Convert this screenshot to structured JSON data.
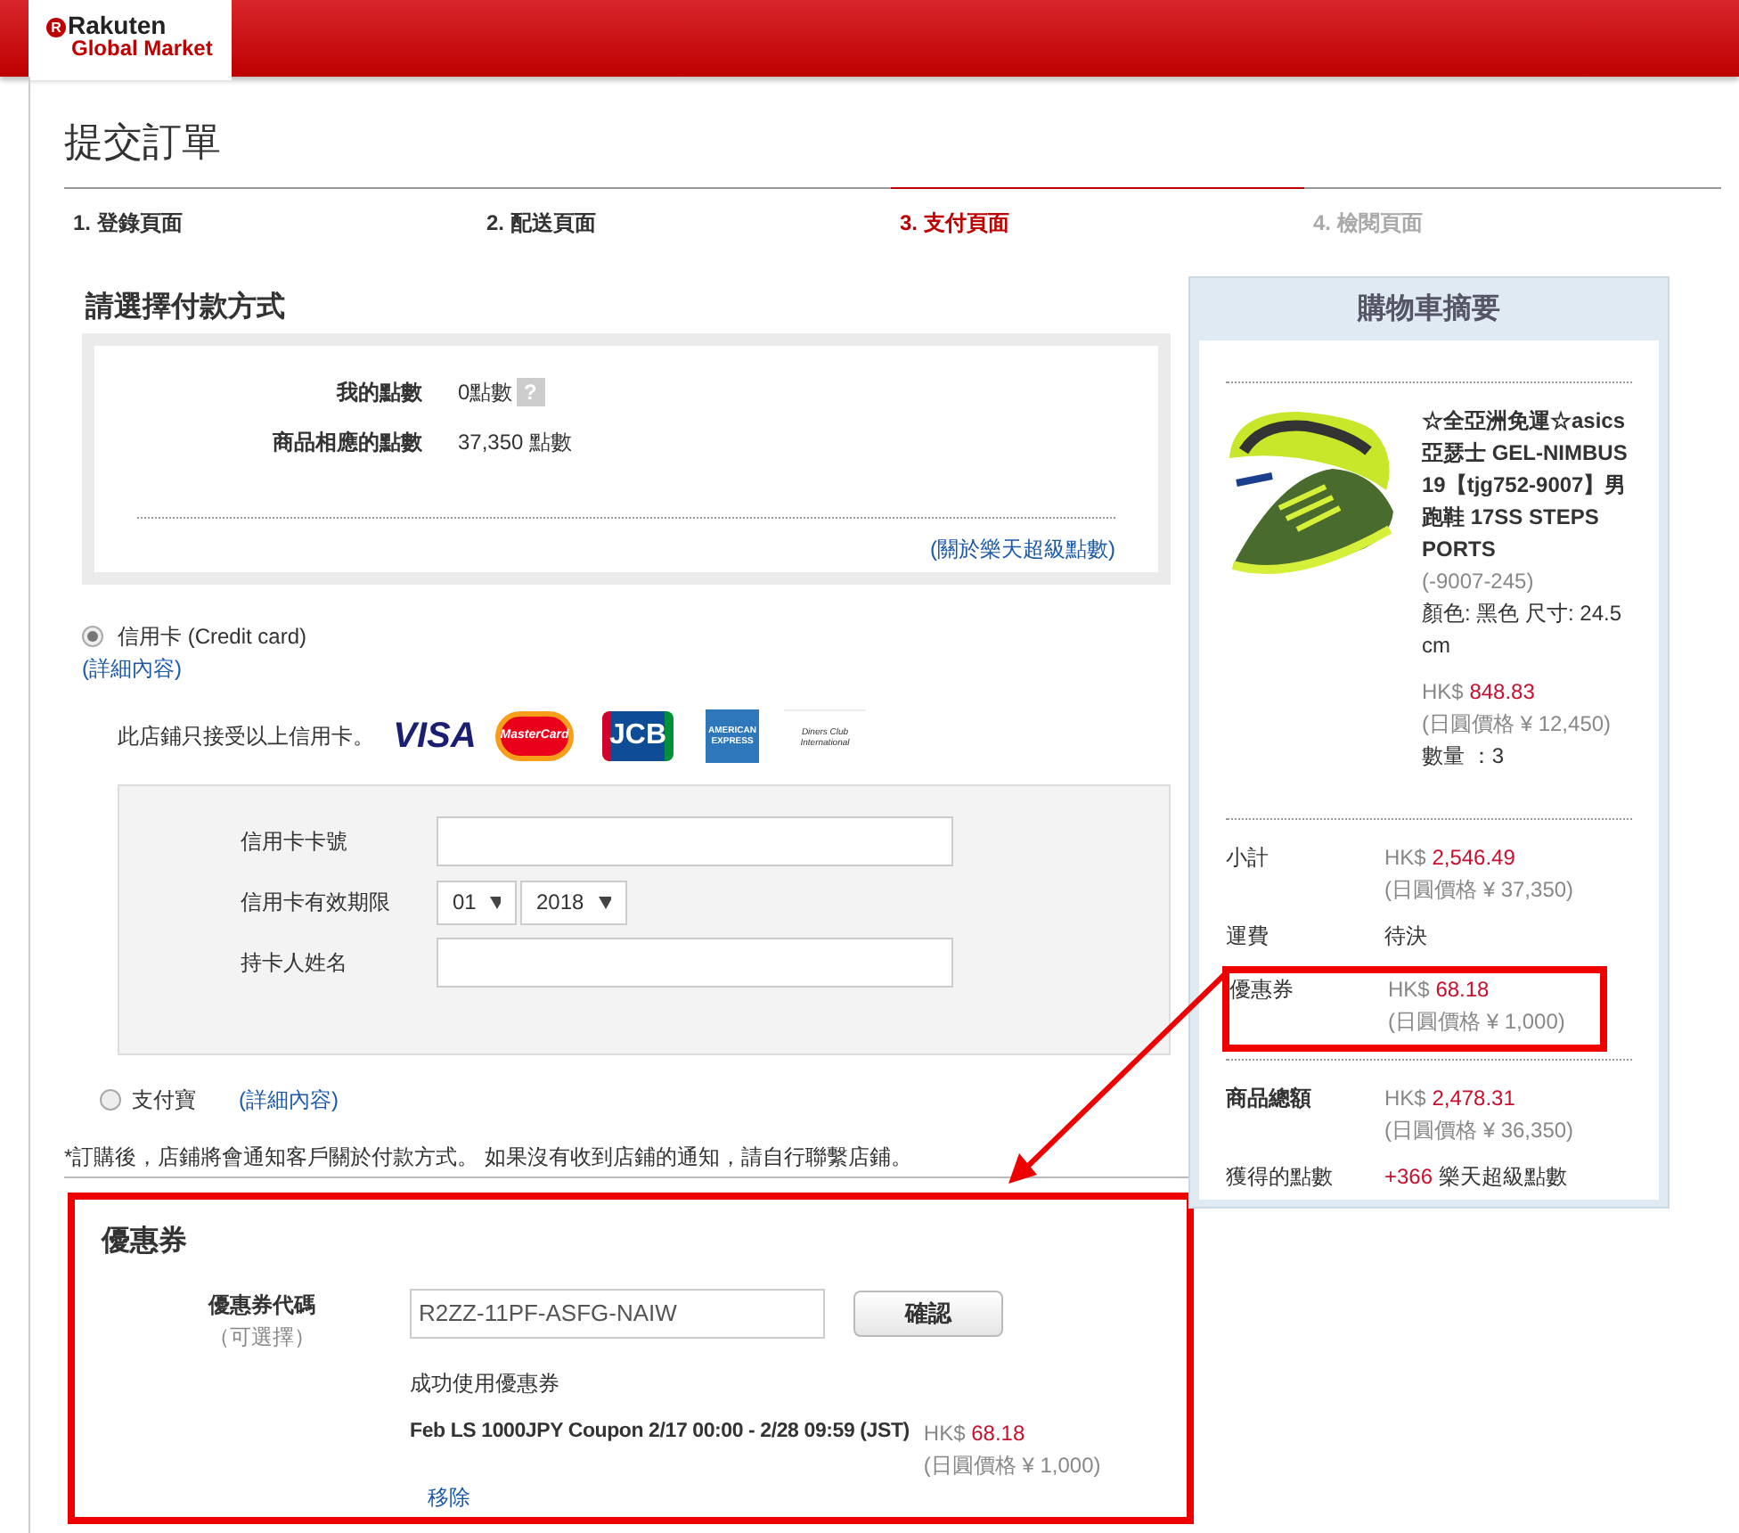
{
  "header": {
    "logo_mark": "R",
    "logo_line1": "Rakuten",
    "logo_line2": "Global Market"
  },
  "page_title": "提交訂單",
  "steps": [
    {
      "label": "1. 登錄頁面",
      "selected": false,
      "disabled": false
    },
    {
      "label": "2. 配送頁面",
      "selected": false,
      "disabled": false
    },
    {
      "label": "3. 支付頁面",
      "selected": true,
      "disabled": false
    },
    {
      "label": "4. 檢閱頁面",
      "selected": false,
      "disabled": true
    }
  ],
  "payment": {
    "heading": "請選擇付款方式",
    "points": [
      {
        "label": "我的點數",
        "value": "0點數",
        "help": "?"
      },
      {
        "label": "商品相應的點數",
        "value": "37,350 點數"
      }
    ],
    "points_link": "(關於樂天超級點數)",
    "credit_card": {
      "label": "信用卡 (Credit card)",
      "selected": true,
      "details_link": "(詳細內容)",
      "note": "此店鋪只接受以上信用卡。",
      "brands": [
        {
          "kind": "visa",
          "text": "VISA"
        },
        {
          "kind": "mastercard",
          "text": "MasterCard"
        },
        {
          "kind": "jcb",
          "text": "JCB"
        },
        {
          "kind": "amex",
          "text": "AMERICAN EXPRESS"
        },
        {
          "kind": "diners",
          "text": "Diners Club International"
        }
      ],
      "fields": [
        {
          "kind": "text",
          "label": "信用卡卡號"
        },
        {
          "kind": "select",
          "label": "信用卡有效期限",
          "options": [
            "01",
            "2018"
          ]
        },
        {
          "kind": "text",
          "label": "持卡人姓名"
        }
      ]
    },
    "alipay": {
      "label": "支付寶",
      "selected": false,
      "details_link": "(詳細內容)"
    },
    "notice": "*訂購後，店鋪將會通知客戶關於付款方式。 如果沒有收到店鋪的通知，請自行聯繫店鋪。"
  },
  "coupon": {
    "highlighted": true,
    "heading": "優惠券",
    "code_label": "優惠券代碼",
    "optional": "（可選擇）",
    "code": "R2ZZ-11PF-ASFG-NAIW",
    "button": "確認",
    "success": "成功使用優惠券",
    "name": "Feb LS 1000JPY Coupon 2/17 00:00 - 2/28 09:59 (JST)",
    "currency": "HK$",
    "amount": "68.18",
    "jpy": "(日圓價格 ¥ 1,000)",
    "remove": "移除"
  },
  "cart": {
    "title": "購物車摘要",
    "item": {
      "name": "☆全亞洲免運☆asics亞瑟士 GEL-NIMBUS 19【tjg752-9007】男跑鞋 17SS STEPS PORTS",
      "code": "(-9007-245)",
      "attributes": "顏色: 黑色 尺寸: 24.5cm",
      "currency": "HK$",
      "amount": "848.83",
      "jpy": "(日圓價格 ¥ 12,450)",
      "quantity": "數量 ：3"
    },
    "totals": [
      {
        "kind": "price",
        "label": "小計",
        "currency": "HK$",
        "amount": "2,546.49",
        "jpy": "(日圓價格 ¥ 37,350)",
        "highlighted": false,
        "emphasized": false
      },
      {
        "kind": "text",
        "label": "運費",
        "value": "待決"
      },
      {
        "kind": "price",
        "label": "優惠券",
        "currency": "HK$",
        "amount": "68.18",
        "jpy": "(日圓價格 ¥ 1,000)",
        "highlighted": true,
        "emphasized": false
      },
      {
        "kind": "price",
        "label": "商品總額",
        "currency": "HK$",
        "amount": "2,478.31",
        "jpy": "(日圓價格 ¥ 36,350)",
        "highlighted": false,
        "emphasized": true
      },
      {
        "kind": "points",
        "label": "獲得的點數",
        "points": "+366",
        "unit": "樂天超級點數"
      }
    ]
  },
  "annotation_arrow": true
}
